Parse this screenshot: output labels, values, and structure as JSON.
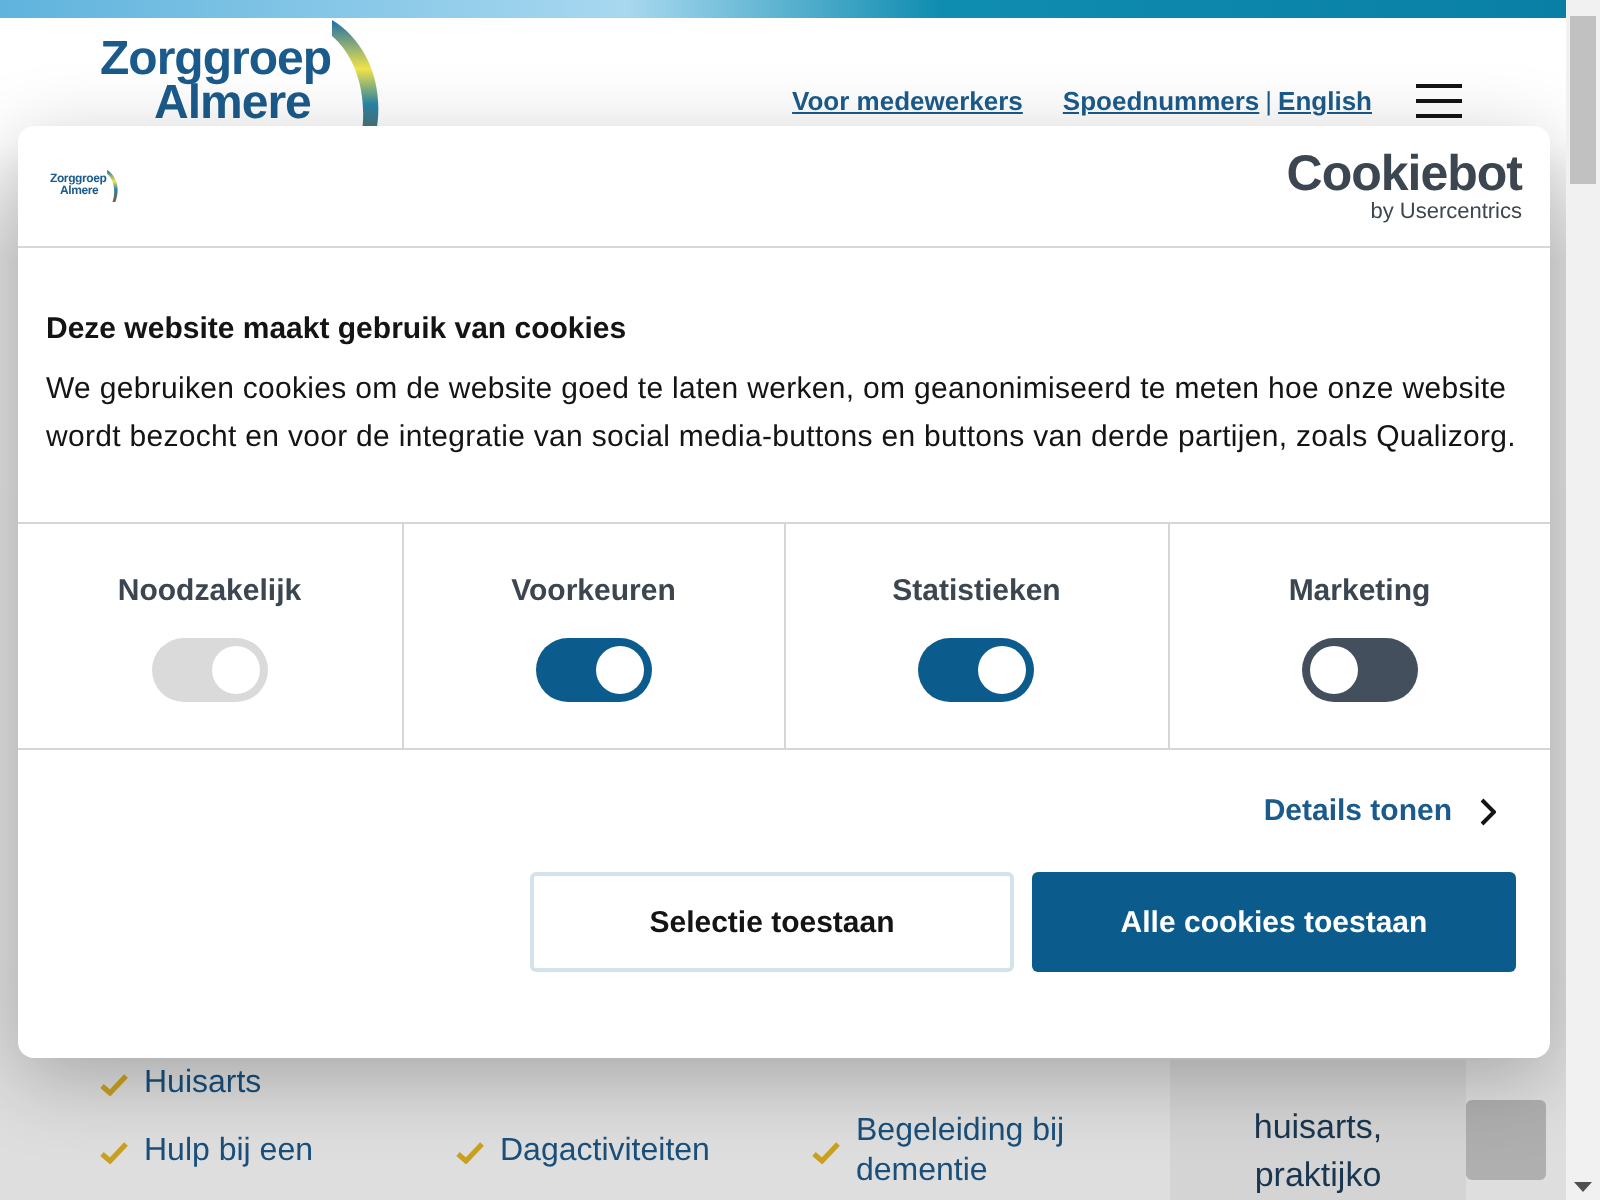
{
  "header": {
    "logo": [
      "Zorggroep",
      "Almere"
    ],
    "links": [
      {
        "label": "Voor medewerkers"
      },
      {
        "label": "Spoednummers"
      },
      {
        "label": "English"
      }
    ],
    "separator": "|"
  },
  "service_rows": [
    [
      {
        "label": "Huisarts"
      }
    ],
    [
      {
        "label": "Hulp bij een"
      },
      {
        "label": "Dagactiviteiten"
      },
      {
        "label": "Begeleiding bij dementie"
      }
    ]
  ],
  "aside": {
    "lines": [
      "huisarts,",
      "praktijko"
    ]
  },
  "cookie_dialog": {
    "logo": [
      "Zorggroep",
      "Almere"
    ],
    "brand": "Cookiebot",
    "brand_sub": "by Usercentrics",
    "title": "Deze website maakt gebruik van cookies",
    "body": "We gebruiken cookies om de website goed te laten werken, om geanonimiseerd te meten hoe onze website wordt bezocht en voor de integratie van social media-buttons en buttons van derde partijen, zoals Qualizorg.",
    "categories": [
      {
        "label": "Noodzakelijk",
        "on": true,
        "disabled": true
      },
      {
        "label": "Voorkeuren",
        "on": true,
        "disabled": false
      },
      {
        "label": "Statistieken",
        "on": true,
        "disabled": false
      },
      {
        "label": "Marketing",
        "on": false,
        "disabled": false
      }
    ],
    "details_link": "Details tonen",
    "buttons": [
      {
        "label": "Selectie toestaan",
        "kind": "outline"
      },
      {
        "label": "Alle cookies toestaan",
        "kind": "primary"
      }
    ]
  }
}
